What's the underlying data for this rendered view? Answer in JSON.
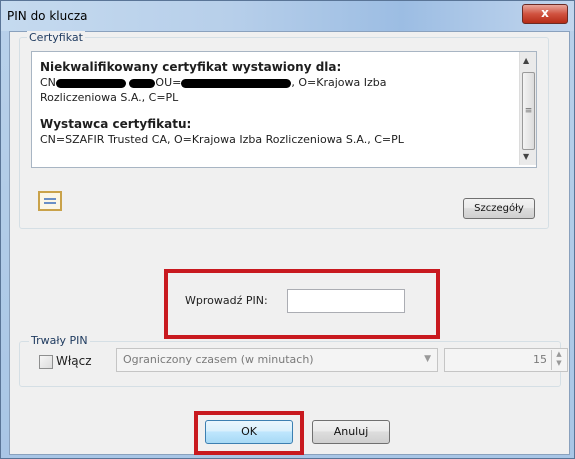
{
  "window": {
    "title": "PIN do klucza",
    "close_label": "x"
  },
  "certificate": {
    "group_label": "Certyfikat",
    "heading": "Niekwalifikowany certyfikat wystawiony dla:",
    "subject_cn_prefix": "CN",
    "subject_ou_prefix": "OU=",
    "subject_tail": ", O=Krajowa Izba",
    "subject_tail2": "Rozliczeniowa S.A., C=PL",
    "issuer_heading": "Wystawca certyfikatu:",
    "issuer": "CN=SZAFIR Trusted CA, O=Krajowa Izba Rozliczeniowa S.A., C=PL",
    "details_button": "Szczegóły"
  },
  "pin_entry": {
    "label": "Wprowadź PIN:",
    "value": ""
  },
  "persistent_pin": {
    "group_label": "Trwały PIN",
    "enable_label": "Włącz",
    "enabled": false,
    "mode_selected": "Ograniczony czasem (w minutach)",
    "minutes": "15"
  },
  "buttons": {
    "ok": "OK",
    "cancel": "Anuluj"
  },
  "colors": {
    "highlight": "#c8191f",
    "accent": "#3c7fb1"
  }
}
